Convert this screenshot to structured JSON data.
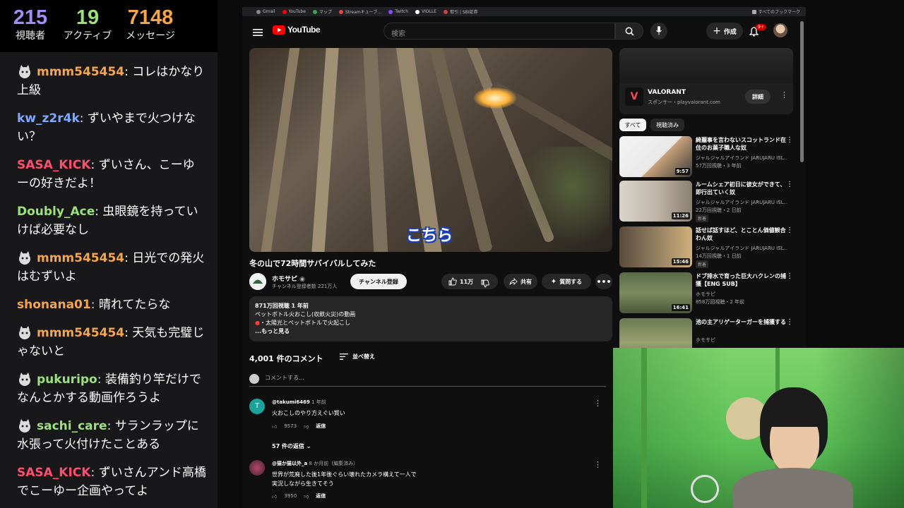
{
  "stats": [
    {
      "value": "215",
      "label": "視聴者",
      "color": "#a58cf5"
    },
    {
      "value": "19",
      "label": "アクティブ",
      "color": "#9be07a"
    },
    {
      "value": "7148",
      "label": "メッセージ",
      "color": "#f5a54a"
    }
  ],
  "chat": [
    {
      "user": "mmm545454",
      "text": "コレはかなり上級",
      "color": "#f5a54a",
      "avatar": true
    },
    {
      "user": "kw_z2r4k",
      "text": "ずいやまで火つけない？",
      "color": "#7fa8ff",
      "avatar": false
    },
    {
      "user": "SASA_KICK",
      "text": "ずいさん、こーゆーの好きだよ！",
      "color": "#ff4d6d",
      "avatar": false
    },
    {
      "user": "Doubly_Ace",
      "text": "虫眼鏡を持っていけば必要なし",
      "color": "#9be07a",
      "avatar": false
    },
    {
      "user": "mmm545454",
      "text": "日光での発火はむずいよ",
      "color": "#f5a54a",
      "avatar": true
    },
    {
      "user": "shonana01",
      "text": "晴れてたらな",
      "color": "#f5a54a",
      "avatar": false
    },
    {
      "user": "mmm545454",
      "text": "天気も完璧じゃないと",
      "color": "#f5a54a",
      "avatar": true
    },
    {
      "user": "pukuripo",
      "text": "装備釣り竿だけでなんとかする動画作ろうよ",
      "color": "#9be07a",
      "avatar": true
    },
    {
      "user": "sachi_care",
      "text": "サランラップに水張って火付けたことある",
      "color": "#9be07a",
      "avatar": true
    },
    {
      "user": "SASA_KICK",
      "text": "ずいさんアンド高橋でこーゆー企画やってよ",
      "color": "#ff4d6d",
      "avatar": false
    }
  ],
  "bookmarks": [
    "Gmail",
    "YouTube",
    "マップ",
    "Streamキューブ…",
    "Twitch",
    "VIOLLE",
    "取引 | SBI証券"
  ],
  "bookmarks_right": "すべてのブックマーク",
  "youtube": {
    "logo": "YouTube",
    "search_placeholder": "検索",
    "create": "作成",
    "notif_count": "9+",
    "video_caption": "こちら",
    "title": "冬の山で72時間サバイバルしてみた",
    "channel": "ホモサピ",
    "subs": "チャンネル登録者数 221万人",
    "subscribe": "チャンネル登録",
    "likes": "11万",
    "share": "共有",
    "ask": "質問する",
    "desc_line1": "871万回視聴  1 年前",
    "desc_line2": "ペットボトル火おこし(収斂火災)の動画",
    "desc_line3": "・太陽光とペットボトルで火起こし",
    "desc_more": "...もっと見る",
    "comment_count": "4,001 件のコメント",
    "sort": "並べ替え",
    "add_comment": "コメントする...",
    "comments": [
      {
        "author": "@takumi6469",
        "when": "1 年前",
        "text": "火おこしのやり方えぐい賢い",
        "likes": "9573",
        "reply": "返信"
      },
      {
        "author": "@猫か猫以外_a",
        "when": "8 か月前（編集済み）",
        "text": "世界が荒廃した後1年後ぐらい壊れたカメラ構えて一人で実況しながら生きてそう",
        "likes": "3950",
        "reply": "返信"
      }
    ],
    "replies": "57 件の返信",
    "ad": {
      "title": "VALORANT",
      "sponsor": "スポンサー・playvalorant.com",
      "button": "詳細"
    },
    "chips": [
      "すべて",
      "視聴済み"
    ],
    "recommended": [
      {
        "title": "綺麗事を言わないスコットランド在住のお菓子職人な奴",
        "channel": "ジャルジャルアイランド JARUJARU ISL...",
        "stats": "57万回視聴・3 年前",
        "duration": "9:57",
        "new": ""
      },
      {
        "title": "ルームシェア初日に彼女ができて、即行出ていく奴",
        "channel": "ジャルジャルアイランド JARUJARU ISL...",
        "stats": "22万回視聴・2 日前",
        "duration": "11:26",
        "new": "新着"
      },
      {
        "title": "話せば話すほど、とことん価値観合わん奴",
        "channel": "ジャルジャルアイランド JARUJARU ISL...",
        "stats": "14万回視聴・1 日前",
        "duration": "15:46",
        "new": "新着"
      },
      {
        "title": "ドブ排水で育った巨大ハクレンの捕獲【ENG SUB】",
        "channel": "ホモサピ",
        "stats": "858万回視聴・2 年前",
        "duration": "16:41",
        "new": ""
      },
      {
        "title": "池の主アリゲーターガーを捕獲する",
        "channel": "ホモサピ",
        "stats": "",
        "duration": "",
        "new": ""
      }
    ]
  }
}
